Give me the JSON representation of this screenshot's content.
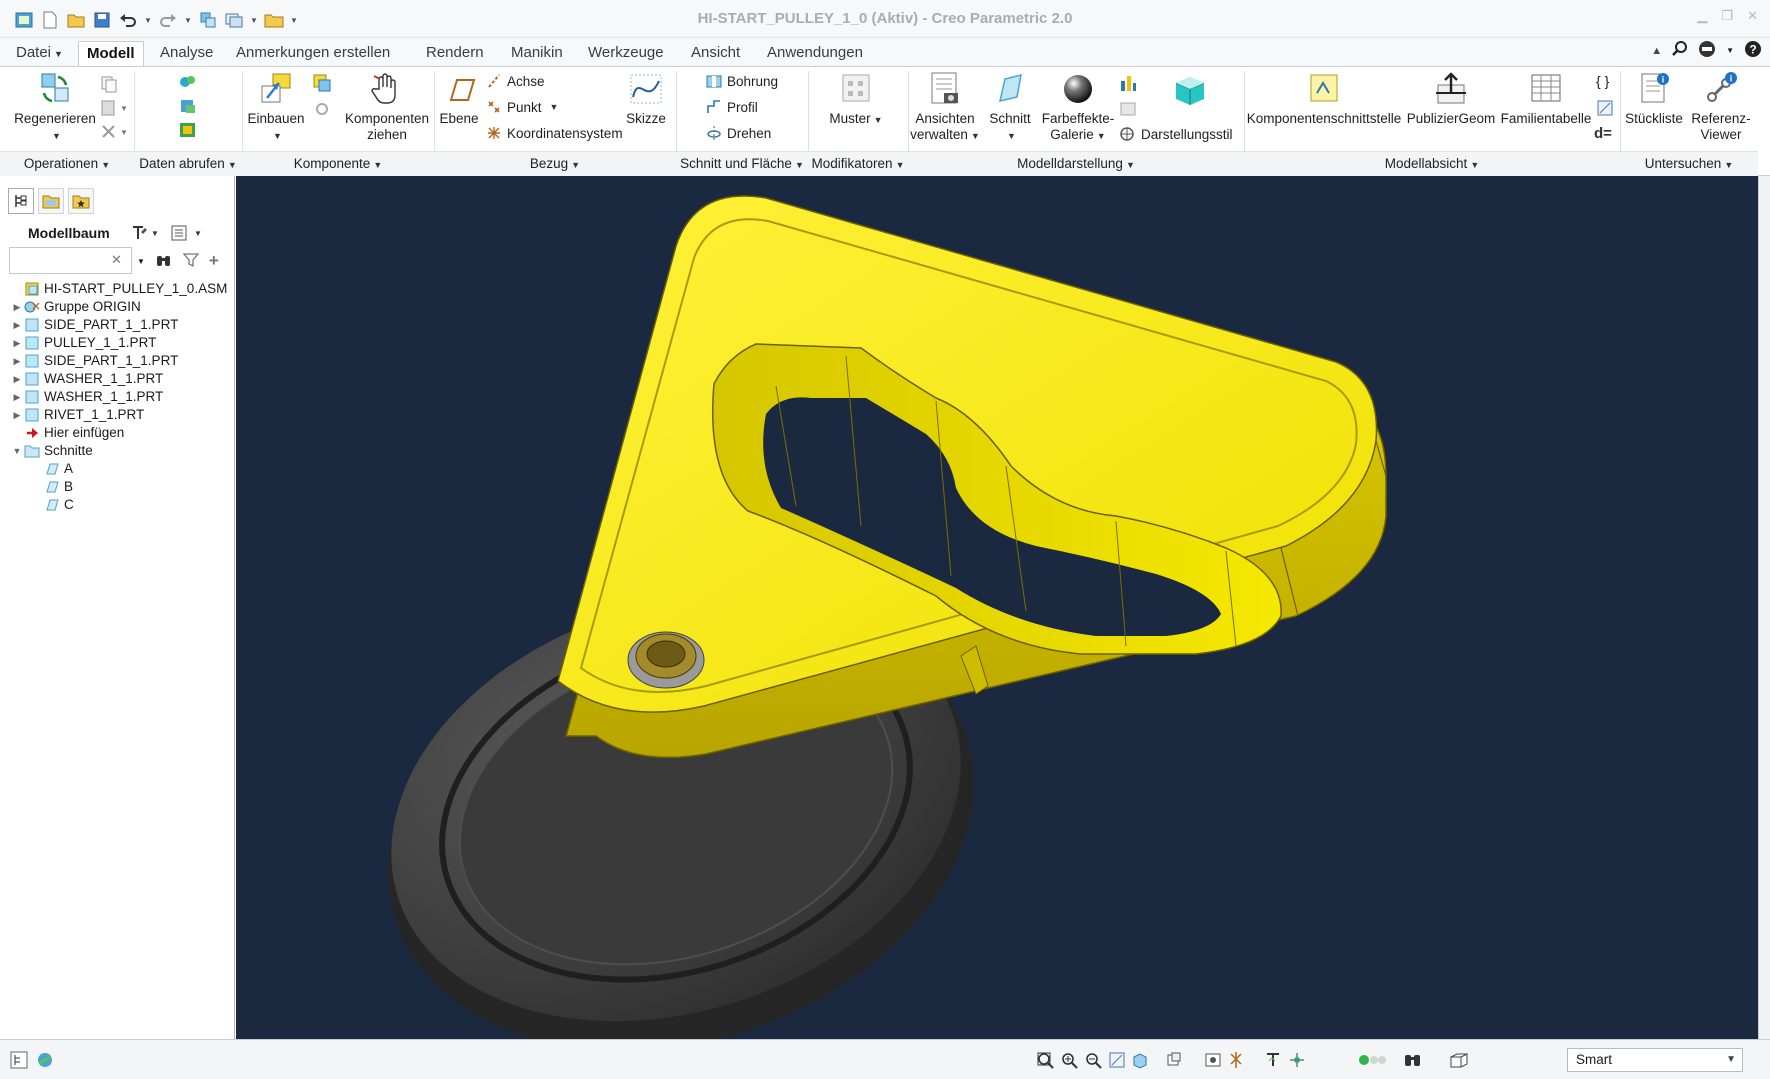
{
  "window": {
    "title": "HI-START_PULLEY_1_0 (Aktiv) - Creo Parametric 2.0",
    "controls": [
      "minimize-icon",
      "restore-icon",
      "close-icon"
    ]
  },
  "tabs": [
    {
      "label": "Datei",
      "active": false,
      "has_dropdown": true
    },
    {
      "label": "Modell",
      "active": true
    },
    {
      "label": "Analyse",
      "active": false
    },
    {
      "label": "Anmerkungen erstellen",
      "active": false
    },
    {
      "label": "Rendern",
      "active": false
    },
    {
      "label": "Manikin",
      "active": false
    },
    {
      "label": "Werkzeuge",
      "active": false
    },
    {
      "label": "Ansicht",
      "active": false
    },
    {
      "label": "Anwendungen",
      "active": false
    }
  ],
  "ribbon": {
    "groups": [
      {
        "label": "Operationen"
      },
      {
        "label": "Daten abrufen"
      },
      {
        "label": "Komponente"
      },
      {
        "label": "Bezug"
      },
      {
        "label": "Schnitt und Fläche"
      },
      {
        "label": "Modifikatoren"
      },
      {
        "label": "Modelldarstellung"
      },
      {
        "label": "Modellabsicht"
      },
      {
        "label": "Untersuchen"
      }
    ],
    "buttons": {
      "regenerieren": "Regenerieren",
      "einbauen": "Einbauen",
      "komponenten_ziehen_1": "Komponenten",
      "komponenten_ziehen_2": "ziehen",
      "ebene": "Ebene",
      "achse": "Achse",
      "punkt": "Punkt",
      "koordinatensystem": "Koordinatensystem",
      "skizze": "Skizze",
      "bohrung": "Bohrung",
      "profil": "Profil",
      "drehen": "Drehen",
      "muster": "Muster",
      "ansichten_1": "Ansichten",
      "ansichten_2": "verwalten",
      "schnitt": "Schnitt",
      "farbeffekte_1": "Farbeffekte-",
      "farbeffekte_2": "Galerie",
      "darstellungsstil": "Darstellungsstil",
      "komponentenschnittstelle": "Komponentenschnittstelle",
      "publiziergeom": "PublizierGeom",
      "familientabelle": "Familientabelle",
      "stueckliste": "Stückliste",
      "referenz_viewer_1": "Referenz-",
      "referenz_viewer_2": "Viewer",
      "d_equals": "d="
    }
  },
  "panel": {
    "title": "Modellbaum",
    "search_value": "",
    "tree": [
      {
        "label": "HI-START_PULLEY_1_0.ASM",
        "level": 0,
        "toggle": "",
        "icon": "assembly-icon"
      },
      {
        "label": "Gruppe ORIGIN",
        "level": 0,
        "toggle": "▶",
        "icon": "group-icon"
      },
      {
        "label": "SIDE_PART_1_1.PRT",
        "level": 0,
        "toggle": "▶",
        "icon": "part-icon"
      },
      {
        "label": "PULLEY_1_1.PRT",
        "level": 0,
        "toggle": "▶",
        "icon": "part-icon"
      },
      {
        "label": "SIDE_PART_1_1.PRT",
        "level": 0,
        "toggle": "▶",
        "icon": "part-icon"
      },
      {
        "label": "WASHER_1_1.PRT",
        "level": 0,
        "toggle": "▶",
        "icon": "part-icon"
      },
      {
        "label": "WASHER_1_1.PRT",
        "level": 0,
        "toggle": "▶",
        "icon": "part-icon"
      },
      {
        "label": "RIVET_1_1.PRT",
        "level": 0,
        "toggle": "▶",
        "icon": "part-icon"
      },
      {
        "label": "Hier einfügen",
        "level": 0,
        "toggle": "",
        "icon": "insert-here-icon"
      },
      {
        "label": "Schnitte",
        "level": 0,
        "toggle": "▼",
        "icon": "sections-folder-icon"
      },
      {
        "label": "A",
        "level": 1,
        "toggle": "",
        "icon": "section-icon"
      },
      {
        "label": "B",
        "level": 1,
        "toggle": "",
        "icon": "section-icon"
      },
      {
        "label": "C",
        "level": 1,
        "toggle": "",
        "icon": "section-icon"
      }
    ]
  },
  "statusbar": {
    "filter_value": "Smart"
  },
  "colors": {
    "viewport_bg": "#1a2940",
    "side_part": "#f2e600",
    "pulley": "#3c3c3c",
    "washer": "#8a7a3a"
  }
}
